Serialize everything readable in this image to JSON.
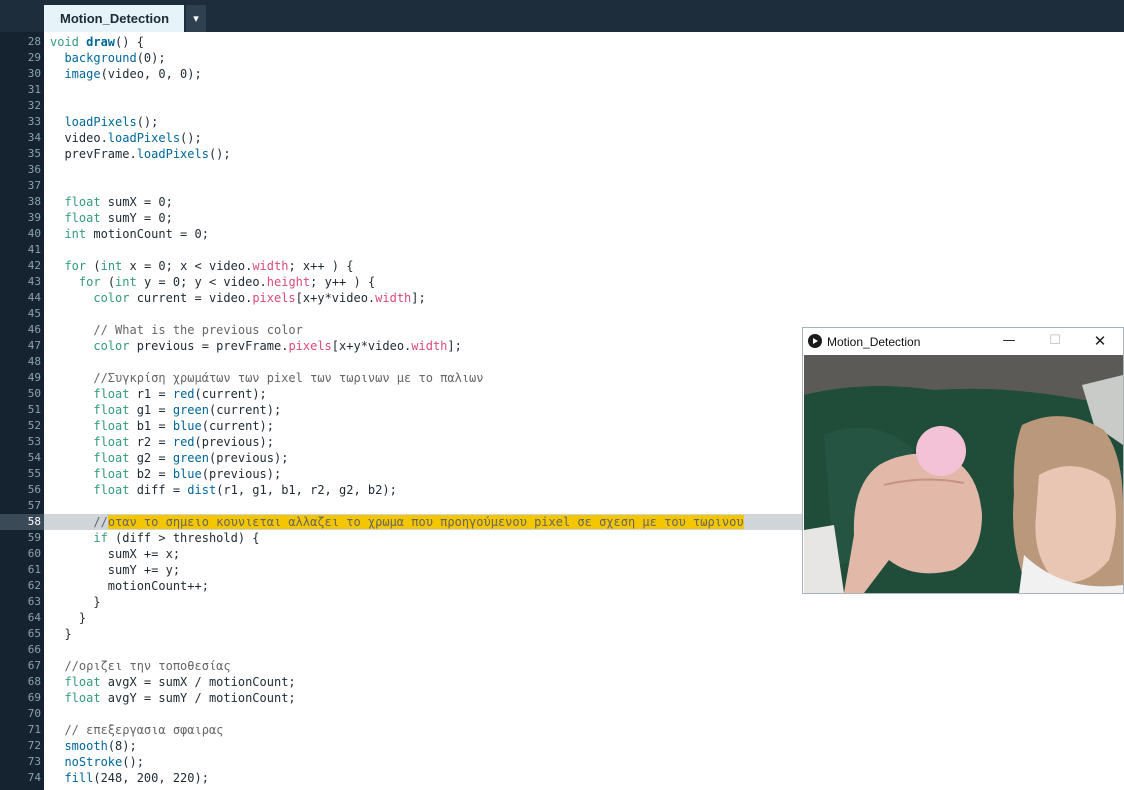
{
  "tab": {
    "title": "Motion_Detection",
    "menu_glyph": "▾"
  },
  "editor": {
    "current_line": 58,
    "lines": [
      {
        "n": 28,
        "segs": [
          [
            "kw",
            "void "
          ],
          [
            "fnd",
            "draw"
          ],
          [
            "",
            "() {"
          ]
        ]
      },
      {
        "n": 29,
        "segs": [
          [
            "",
            "  "
          ],
          [
            "fn",
            "background"
          ],
          [
            "",
            "(0);"
          ]
        ]
      },
      {
        "n": 30,
        "segs": [
          [
            "",
            "  "
          ],
          [
            "fn",
            "image"
          ],
          [
            "",
            "(video, 0, 0);"
          ]
        ]
      },
      {
        "n": 31,
        "segs": []
      },
      {
        "n": 32,
        "segs": []
      },
      {
        "n": 33,
        "segs": [
          [
            "",
            "  "
          ],
          [
            "fn",
            "loadPixels"
          ],
          [
            "",
            "();"
          ]
        ]
      },
      {
        "n": 34,
        "segs": [
          [
            "",
            "  video."
          ],
          [
            "fn",
            "loadPixels"
          ],
          [
            "",
            "();"
          ]
        ]
      },
      {
        "n": 35,
        "segs": [
          [
            "",
            "  prevFrame."
          ],
          [
            "fn",
            "loadPixels"
          ],
          [
            "",
            "();"
          ]
        ]
      },
      {
        "n": 36,
        "segs": []
      },
      {
        "n": 37,
        "segs": []
      },
      {
        "n": 38,
        "segs": [
          [
            "",
            "  "
          ],
          [
            "kw",
            "float"
          ],
          [
            "",
            " sumX = 0;"
          ]
        ]
      },
      {
        "n": 39,
        "segs": [
          [
            "",
            "  "
          ],
          [
            "kw",
            "float"
          ],
          [
            "",
            " sumY = 0;"
          ]
        ]
      },
      {
        "n": 40,
        "segs": [
          [
            "",
            "  "
          ],
          [
            "kw",
            "int"
          ],
          [
            "",
            " motionCount = 0;"
          ]
        ]
      },
      {
        "n": 41,
        "segs": []
      },
      {
        "n": 42,
        "segs": [
          [
            "",
            "  "
          ],
          [
            "kw",
            "for"
          ],
          [
            "",
            " ("
          ],
          [
            "kw",
            "int"
          ],
          [
            "",
            " x = 0; x < video."
          ],
          [
            "prop",
            "width"
          ],
          [
            "",
            "; x++ ) {"
          ]
        ]
      },
      {
        "n": 43,
        "segs": [
          [
            "",
            "    "
          ],
          [
            "kw",
            "for"
          ],
          [
            "",
            " ("
          ],
          [
            "kw",
            "int"
          ],
          [
            "",
            " y = 0; y < video."
          ],
          [
            "prop",
            "height"
          ],
          [
            "",
            "; y++ ) {"
          ]
        ]
      },
      {
        "n": 44,
        "segs": [
          [
            "",
            "      "
          ],
          [
            "kw",
            "color"
          ],
          [
            "",
            " current = video."
          ],
          [
            "prop",
            "pixels"
          ],
          [
            "",
            "[x+y*video."
          ],
          [
            "prop",
            "width"
          ],
          [
            "",
            "];"
          ]
        ]
      },
      {
        "n": 45,
        "segs": []
      },
      {
        "n": 46,
        "segs": [
          [
            "",
            "      "
          ],
          [
            "cm",
            "// What is the previous color"
          ]
        ]
      },
      {
        "n": 47,
        "segs": [
          [
            "",
            "      "
          ],
          [
            "kw",
            "color"
          ],
          [
            "",
            " previous = prevFrame."
          ],
          [
            "prop",
            "pixels"
          ],
          [
            "",
            "[x+y*video."
          ],
          [
            "prop",
            "width"
          ],
          [
            "",
            "];"
          ]
        ]
      },
      {
        "n": 48,
        "segs": []
      },
      {
        "n": 49,
        "segs": [
          [
            "",
            "      "
          ],
          [
            "cm",
            "//Συγκρίση χρωμάτων των pixel των τωρινων με το παλιων"
          ]
        ]
      },
      {
        "n": 50,
        "segs": [
          [
            "",
            "      "
          ],
          [
            "kw",
            "float"
          ],
          [
            "",
            " r1 = "
          ],
          [
            "fn",
            "red"
          ],
          [
            "",
            "(current);"
          ]
        ]
      },
      {
        "n": 51,
        "segs": [
          [
            "",
            "      "
          ],
          [
            "kw",
            "float"
          ],
          [
            "",
            " g1 = "
          ],
          [
            "fn",
            "green"
          ],
          [
            "",
            "(current);"
          ]
        ]
      },
      {
        "n": 52,
        "segs": [
          [
            "",
            "      "
          ],
          [
            "kw",
            "float"
          ],
          [
            "",
            " b1 = "
          ],
          [
            "fn",
            "blue"
          ],
          [
            "",
            "(current);"
          ]
        ]
      },
      {
        "n": 53,
        "segs": [
          [
            "",
            "      "
          ],
          [
            "kw",
            "float"
          ],
          [
            "",
            " r2 = "
          ],
          [
            "fn",
            "red"
          ],
          [
            "",
            "(previous);"
          ]
        ]
      },
      {
        "n": 54,
        "segs": [
          [
            "",
            "      "
          ],
          [
            "kw",
            "float"
          ],
          [
            "",
            " g2 = "
          ],
          [
            "fn",
            "green"
          ],
          [
            "",
            "(previous);"
          ]
        ]
      },
      {
        "n": 55,
        "segs": [
          [
            "",
            "      "
          ],
          [
            "kw",
            "float"
          ],
          [
            "",
            " b2 = "
          ],
          [
            "fn",
            "blue"
          ],
          [
            "",
            "(previous);"
          ]
        ]
      },
      {
        "n": 56,
        "segs": [
          [
            "",
            "      "
          ],
          [
            "kw",
            "float"
          ],
          [
            "",
            " diff = "
          ],
          [
            "fn",
            "dist"
          ],
          [
            "",
            "(r1, g1, b1, r2, g2, b2);"
          ]
        ]
      },
      {
        "n": 57,
        "segs": []
      },
      {
        "n": 58,
        "segs": [
          [
            "",
            "      "
          ],
          [
            "cm",
            "//"
          ],
          [
            "hl",
            "οταν το σημειο κουνιεται αλλαζει το χρωμα που προηγούμενου pixel σε σχεση με του τωρινου"
          ]
        ]
      },
      {
        "n": 59,
        "segs": [
          [
            "",
            "      "
          ],
          [
            "kw",
            "if"
          ],
          [
            "",
            " (diff > threshold) {"
          ]
        ]
      },
      {
        "n": 60,
        "segs": [
          [
            "",
            "        sumX += x;"
          ]
        ]
      },
      {
        "n": 61,
        "segs": [
          [
            "",
            "        sumY += y;"
          ]
        ]
      },
      {
        "n": 62,
        "segs": [
          [
            "",
            "        motionCount++;"
          ]
        ]
      },
      {
        "n": 63,
        "segs": [
          [
            "",
            "      }"
          ]
        ]
      },
      {
        "n": 64,
        "segs": [
          [
            "",
            "    }"
          ]
        ]
      },
      {
        "n": 65,
        "segs": [
          [
            "",
            "  }"
          ]
        ]
      },
      {
        "n": 66,
        "segs": []
      },
      {
        "n": 67,
        "segs": [
          [
            "",
            "  "
          ],
          [
            "cm",
            "//οριζει την τοποθεσίας"
          ]
        ]
      },
      {
        "n": 68,
        "segs": [
          [
            "",
            "  "
          ],
          [
            "kw",
            "float"
          ],
          [
            "",
            " avgX = sumX / motionCount;"
          ]
        ]
      },
      {
        "n": 69,
        "segs": [
          [
            "",
            "  "
          ],
          [
            "kw",
            "float"
          ],
          [
            "",
            " avgY = sumY / motionCount;"
          ]
        ]
      },
      {
        "n": 70,
        "segs": []
      },
      {
        "n": 71,
        "segs": [
          [
            "",
            "  "
          ],
          [
            "cm",
            "// επεξεργασια σφαιρας"
          ]
        ]
      },
      {
        "n": 72,
        "segs": [
          [
            "",
            "  "
          ],
          [
            "fn",
            "smooth"
          ],
          [
            "",
            "(8);"
          ]
        ]
      },
      {
        "n": 73,
        "segs": [
          [
            "",
            "  "
          ],
          [
            "fn",
            "noStroke"
          ],
          [
            "",
            "();"
          ]
        ]
      },
      {
        "n": 74,
        "segs": [
          [
            "",
            "  "
          ],
          [
            "fn",
            "fill"
          ],
          [
            "",
            "(248, 200, 220);"
          ]
        ]
      }
    ]
  },
  "sketch_window": {
    "title": "Motion_Detection",
    "minimize_glyph": "—",
    "maximize_glyph": "☐",
    "close_glyph": "✕",
    "ball_color": "#f3c2d7"
  },
  "colors": {
    "header_bg": "#1d2d3c",
    "gutter_bg": "#14232f",
    "keyword": "#33997e",
    "function": "#006699",
    "property": "#d94a7a",
    "comment": "#666666",
    "highlight": "#f3c600"
  }
}
